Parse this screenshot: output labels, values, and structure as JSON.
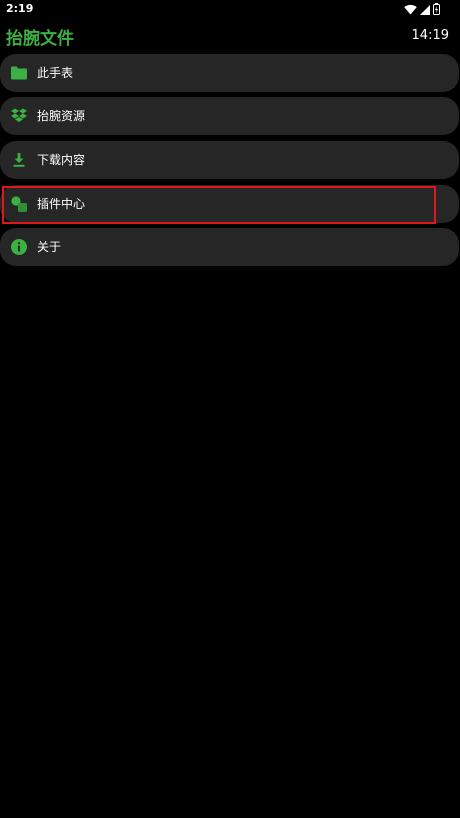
{
  "status_bar": {
    "time": "2:19",
    "icons": [
      "wifi-icon",
      "signal-icon",
      "battery-icon"
    ]
  },
  "header": {
    "title": "抬腕文件",
    "clock": "14:19"
  },
  "menu": {
    "items": [
      {
        "label": "此手表",
        "icon": "folder-icon"
      },
      {
        "label": "抬腕资源",
        "icon": "dropbox-icon"
      },
      {
        "label": "下载内容",
        "icon": "download-icon"
      },
      {
        "label": "插件中心",
        "icon": "shapes-icon",
        "highlighted": true
      },
      {
        "label": "关于",
        "icon": "info-icon"
      }
    ]
  },
  "colors": {
    "accent": "#3cb043",
    "item_background": "#262626",
    "background": "#000000",
    "highlight_border": "#e0161b"
  }
}
